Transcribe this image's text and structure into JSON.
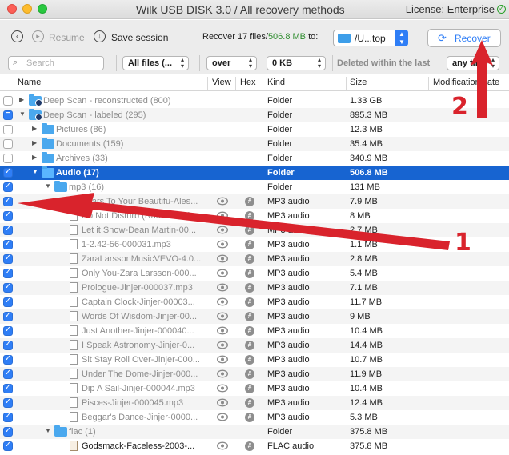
{
  "window": {
    "title": "Wilk USB DISK 3.0 / All recovery methods",
    "license": "License: Enterprise"
  },
  "toolbar": {
    "resume_label": "Resume",
    "save_session_label": "Save session",
    "recover_prefix": "Recover 17 files/",
    "recover_size": "506.8 MB",
    "recover_to": " to:",
    "destination": "/U...top",
    "recover_button": "Recover"
  },
  "filters": {
    "search_placeholder": "Search",
    "file_types": "All files (...",
    "size_op": "over",
    "size_value": "0 KB",
    "deleted_label": "Deleted within the last",
    "time_value": "any time"
  },
  "columns": {
    "name": "Name",
    "view": "View",
    "hex": "Hex",
    "kind": "Kind",
    "size": "Size",
    "modified": "Modification date"
  },
  "rows": [
    {
      "name": "Deep Scan - reconstructed (800)",
      "kind": "Folder",
      "size": "1.33 GB"
    },
    {
      "name": "Deep Scan - labeled (295)",
      "kind": "Folder",
      "size": "895.3 MB"
    },
    {
      "name": "Pictures (86)",
      "kind": "Folder",
      "size": "12.3 MB"
    },
    {
      "name": "Documents (159)",
      "kind": "Folder",
      "size": "35.4 MB"
    },
    {
      "name": "Archives (33)",
      "kind": "Folder",
      "size": "340.9 MB"
    },
    {
      "name": "Audio (17)",
      "kind": "Folder",
      "size": "506.8 MB"
    },
    {
      "name": "mp3 (16)",
      "kind": "Folder",
      "size": "131 MB"
    },
    {
      "name": "Scars To Your Beautifu-Ales...",
      "kind": "MP3 audio",
      "size": "7.9 MB"
    },
    {
      "name": "Do Not Disturb (Radio Versio...",
      "kind": "MP3 audio",
      "size": "8 MB"
    },
    {
      "name": "Let it Snow-Dean Martin-00...",
      "kind": "MP3 audio",
      "size": "2.7 MB"
    },
    {
      "name": "1-2.42-56-000031.mp3",
      "kind": "MP3 audio",
      "size": "1.1 MB"
    },
    {
      "name": "ZaraLarssonMusicVEVO-4.0...",
      "kind": "MP3 audio",
      "size": "2.8 MB"
    },
    {
      "name": "Only You-Zara Larsson-000...",
      "kind": "MP3 audio",
      "size": "5.4 MB"
    },
    {
      "name": "Prologue-Jinjer-000037.mp3",
      "kind": "MP3 audio",
      "size": "7.1 MB"
    },
    {
      "name": "Captain Clock-Jinjer-00003...",
      "kind": "MP3 audio",
      "size": "11.7 MB"
    },
    {
      "name": "Words Of Wisdom-Jinjer-00...",
      "kind": "MP3 audio",
      "size": "9 MB"
    },
    {
      "name": "Just Another-Jinjer-000040...",
      "kind": "MP3 audio",
      "size": "10.4 MB"
    },
    {
      "name": "I Speak Astronomy-Jinjer-0...",
      "kind": "MP3 audio",
      "size": "14.4 MB"
    },
    {
      "name": "Sit Stay Roll Over-Jinjer-000...",
      "kind": "MP3 audio",
      "size": "10.7 MB"
    },
    {
      "name": "Under The Dome-Jinjer-000...",
      "kind": "MP3 audio",
      "size": "11.9 MB"
    },
    {
      "name": "Dip A Sail-Jinjer-000044.mp3",
      "kind": "MP3 audio",
      "size": "10.4 MB"
    },
    {
      "name": "Pisces-Jinjer-000045.mp3",
      "kind": "MP3 audio",
      "size": "12.4 MB"
    },
    {
      "name": "Beggar's Dance-Jinjer-0000...",
      "kind": "MP3 audio",
      "size": "5.3 MB"
    },
    {
      "name": "flac (1)",
      "kind": "Folder",
      "size": "375.8 MB"
    },
    {
      "name": "Godsmack-Faceless-2003-...",
      "kind": "FLAC audio",
      "size": "375.8 MB"
    }
  ],
  "annotations": {
    "step1": "1",
    "step2": "2"
  },
  "colors": {
    "selection": "#1764d1",
    "accent": "#2f7ef6",
    "annotation": "#d9232c"
  }
}
